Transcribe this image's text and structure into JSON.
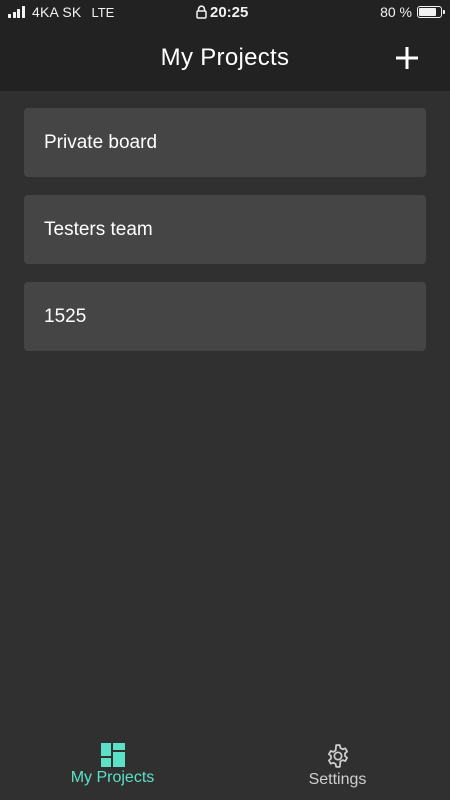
{
  "status_bar": {
    "carrier": "4KA SK",
    "network": "LTE",
    "time": "20:25",
    "battery": "80 %",
    "battery_level": 0.8
  },
  "header": {
    "title": "My Projects",
    "add_icon": "plus-icon"
  },
  "projects": [
    {
      "name": "Private board"
    },
    {
      "name": "Testers team"
    },
    {
      "name": "1525"
    }
  ],
  "tabs": [
    {
      "label": "My Projects",
      "icon": "dashboard-icon",
      "active": true
    },
    {
      "label": "Settings",
      "icon": "gear-icon",
      "active": false
    }
  ],
  "colors": {
    "accent": "#5ce1c6",
    "background": "#303030",
    "header": "#222222",
    "card": "#454545"
  }
}
